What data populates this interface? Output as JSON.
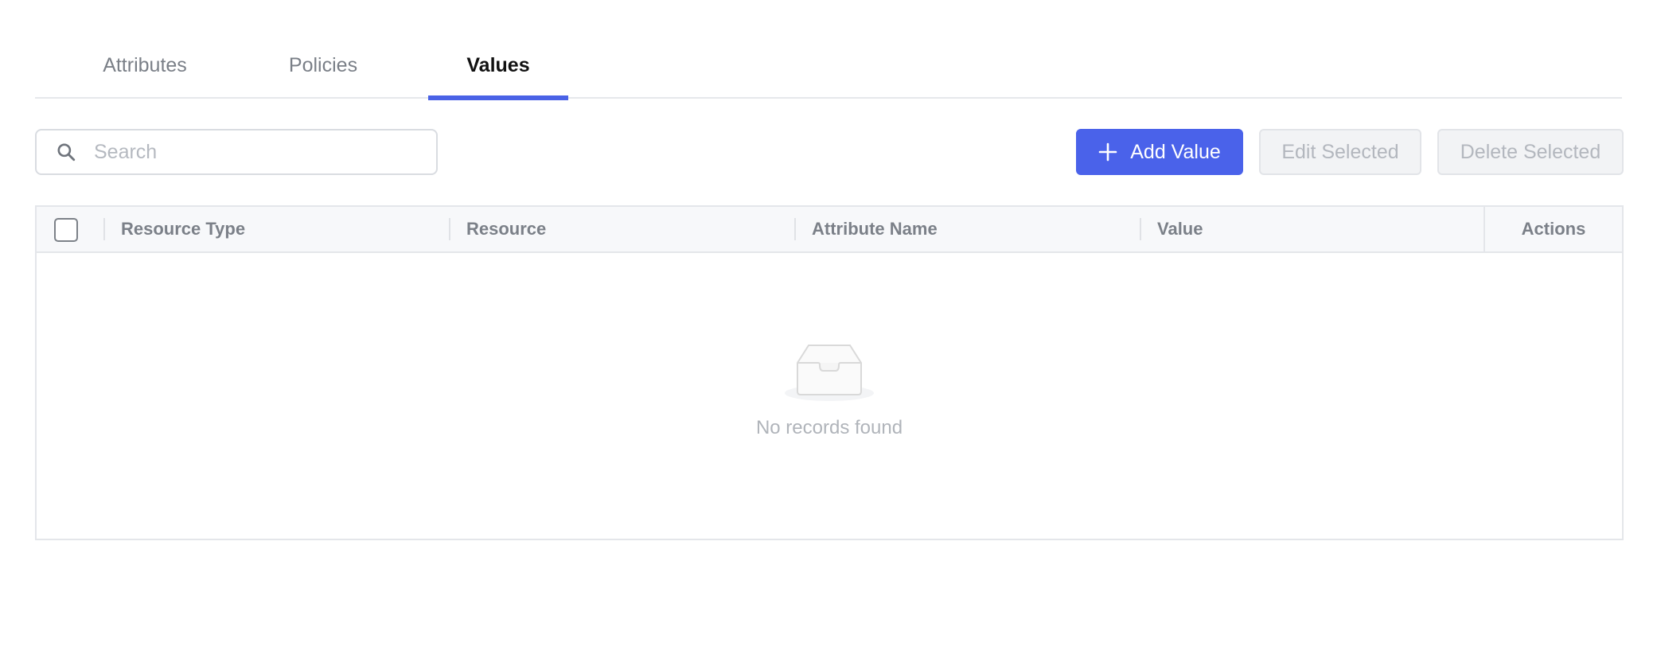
{
  "tabs": [
    {
      "label": "Attributes",
      "active": false
    },
    {
      "label": "Policies",
      "active": false
    },
    {
      "label": "Values",
      "active": true
    }
  ],
  "search": {
    "placeholder": "Search",
    "value": "",
    "icon": "search-icon"
  },
  "toolbar": {
    "add_label": "Add Value",
    "edit_label": "Edit Selected",
    "delete_label": "Delete Selected"
  },
  "table": {
    "columns": [
      "Resource Type",
      "Resource",
      "Attribute Name",
      "Value"
    ],
    "actions_label": "Actions",
    "rows": [],
    "empty_text": "No records found"
  },
  "colors": {
    "accent": "#4a62ea",
    "disabled_bg": "#f2f3f5",
    "disabled_text": "#b3b7be"
  }
}
